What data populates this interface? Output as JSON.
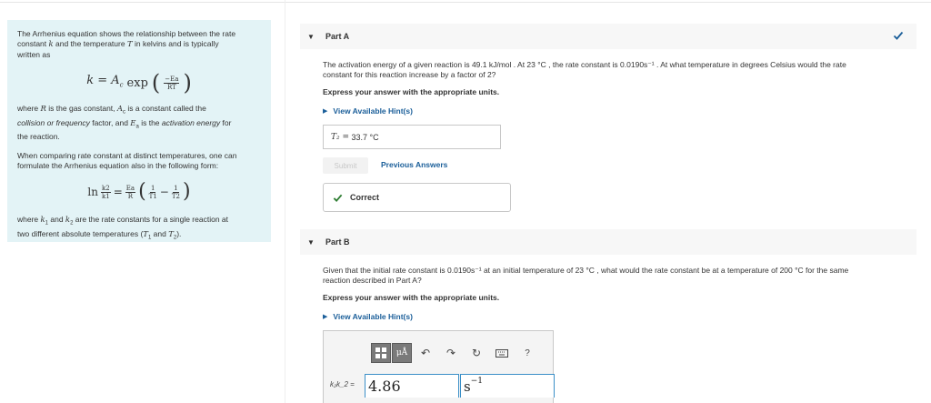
{
  "info_panel": {
    "intro_1": "The Arrhenius equation shows the relationship between the rate",
    "intro_2a": "constant ",
    "intro_k": "k",
    "intro_2b": " and the temperature ",
    "intro_T": "T",
    "intro_2c": " in kelvins and is typically",
    "intro_3": "written as",
    "eq1_lhs": "k = A",
    "eq1_sub": "c",
    "eq1_exp": "exp",
    "eq1_num": "−Ea",
    "eq1_den": "RT",
    "where_1a": "where ",
    "where_R": "R",
    "where_1b": " is the gas constant, ",
    "where_A": "A",
    "where_A_sub": "c",
    "where_1c": " is a constant called the",
    "where_2a": "collision or frequency",
    "where_2b": " factor, and ",
    "where_E": "E",
    "where_E_sub": "a",
    "where_2c": " is the ",
    "where_2d": "activation energy",
    "where_2e": " for",
    "where_3": "the reaction.",
    "comp_1": "When comparing rate constant at distinct temperatures, one can",
    "comp_2": "formulate the Arrhenius equation also in the following form:",
    "eq2_ln": "ln",
    "eq2_k_num": "k2",
    "eq2_k_den": "k1",
    "eq2_E_num": "Ea",
    "eq2_E_den": "R",
    "eq2_t1_num": "1",
    "eq2_t1_den": "T1",
    "eq2_t2_num": "1",
    "eq2_t2_den": "T2",
    "final_1a": "where ",
    "final_k1": "k",
    "final_k1_sub": "1",
    "final_1b": " and ",
    "final_k2": "k",
    "final_k2_sub": "2",
    "final_1c": " are the rate constants for a single reaction at",
    "final_2a": "two different absolute temperatures (",
    "final_T1": "T",
    "final_T1_sub": "1",
    "final_2b": " and ",
    "final_T2": "T",
    "final_T2_sub": "2",
    "final_2c": ")."
  },
  "part_a": {
    "title": "Part A",
    "question_1": "The activation energy of a given reaction is 49.1 kJ/mol . At 23 °C , the rate constant is 0.0190s⁻¹ . At what temperature in degrees Celsius would the rate",
    "question_2": "constant for this reaction increase by a factor of 2?",
    "instruction": "Express your answer with the appropriate units.",
    "hint_label": "View Available Hint(s)",
    "answer_label": "T₂ =",
    "answer_value": "33.7 °C",
    "submit_label": "Submit",
    "previous_label": "Previous Answers",
    "correct_label": "Correct"
  },
  "part_b": {
    "title": "Part B",
    "question_1": "Given that the initial rate constant is 0.0190s⁻¹ at an initial temperature of 23 °C , what would the rate constant be at a temperature of 200 °C for the same",
    "question_2": "reaction described in Part A?",
    "instruction": "Express your answer with the appropriate units.",
    "hint_label": "View Available Hint(s)",
    "input_label": "k₂k_2 =",
    "input_value": "4.86",
    "unit_base": "s",
    "unit_exp": "−1",
    "toolbar_mu": "μÅ",
    "toolbar_help": "?"
  },
  "colors": {
    "accent": "#1a5e99",
    "check": "#2e7d32",
    "panel": "#e3f3f6"
  }
}
